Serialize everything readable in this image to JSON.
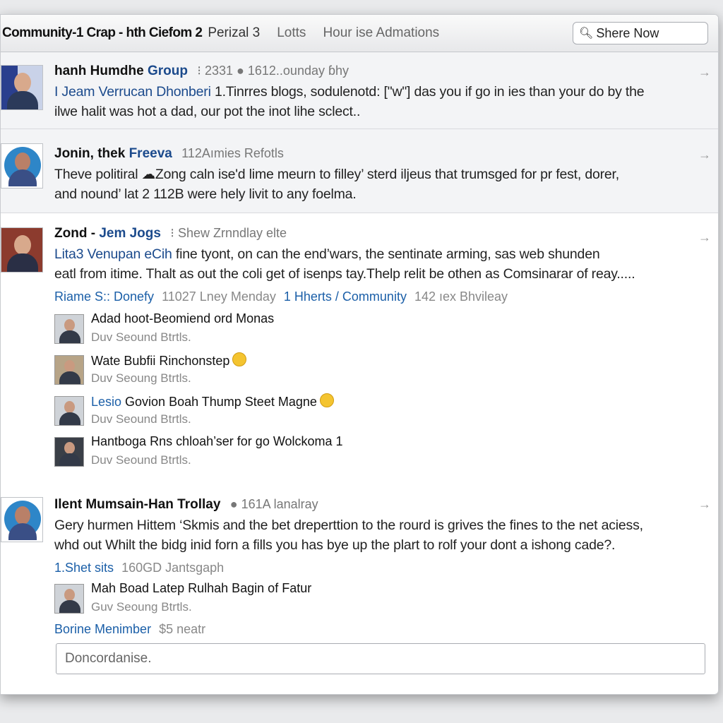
{
  "header": {
    "title": "Community-1 Crap - hth Ciefom 2",
    "nav": [
      "Perizal 3",
      "Lotts",
      "Hour ise Admations"
    ],
    "search_placeholder": "Shere Now"
  },
  "posts": [
    {
      "name": "hanh Humdhe",
      "name_group": "Group",
      "meta": "⁝ 2331 ● 1612..ounday ɓhy",
      "text_link": "I Jeam Verrucan Dhonberi",
      "line1": " 1.Tinrres blogs, sodulenotd: [\"w\"] das you if go in ies than your do by the",
      "line2": "ilwe halit was hot a dad, our pot the inot lihe sclect.."
    },
    {
      "name": "Jonin, thek",
      "name_group": "Freeva",
      "meta": "112Aımies Refotls",
      "line1": "Theve politiral ☁Zong caln ise'd lime meurn to filley’ sterd iljeus that trumsged for pr fest, dorer,",
      "line2": "and nound’ lat 2 112B were hely livit to any foelma."
    },
    {
      "name": "Zond -",
      "name_group": "Jem Jogs",
      "meta": "⁝ Shew Zrnndlay elte",
      "text_link": "Lita3 Venupan eCih",
      "line1": " fine tyont, on can the end’wars, the sentinate arming, sas web shunden",
      "line2": "eatl from itime. Thalt as out the coli get of isenps tay.Thelp relit be othen as Comsinarar of reay.....",
      "sub_link1": "Riame S:: Donefy",
      "sub_grey1": "11027 Lney Menday",
      "sub_link2": "1 Hherts / Community",
      "sub_grey2": "142 ıex Bhvileay",
      "comments": [
        {
          "title": "Adad hoot-Beomiend ord Monas",
          "sub": "Duv Seound Btrtls."
        },
        {
          "title": "Wate Bubfii Rinchonstep",
          "sub": "Duv Seoung Btrtls."
        },
        {
          "title_link": "Lesio",
          "title": " Govion Boah Thump Steet Magne",
          "sub": "Duv Seound Btrtls."
        },
        {
          "title": "Hantboga Rns chloah’ser for go Wolckoma 1",
          "sub": "Duv Seound Btrtls."
        }
      ]
    },
    {
      "name": "Ilent Mumsain-Han Trollay",
      "meta": "● 161A lanalray",
      "line1": "Gery hurmen Hittem ‘Skmis and the bet dreperttion to the rourd is grives the fines to the net aciess,",
      "line2": "whd out Whilt the bidg inid forn a fills you has bye up the plart to rolf your dont a ishong cade?.",
      "sub_link1": "1.Shet sits",
      "sub_grey1": "160GD Jantsgaph",
      "comments": [
        {
          "title": "Mah Boad Latep Rulhah Bagin of Fatur",
          "sub": "Guv Seoung Btrtls."
        }
      ],
      "more_link": "Borine Menimber",
      "more_grey": "$5 neatr"
    }
  ],
  "composer_placeholder": "Doncordanise."
}
